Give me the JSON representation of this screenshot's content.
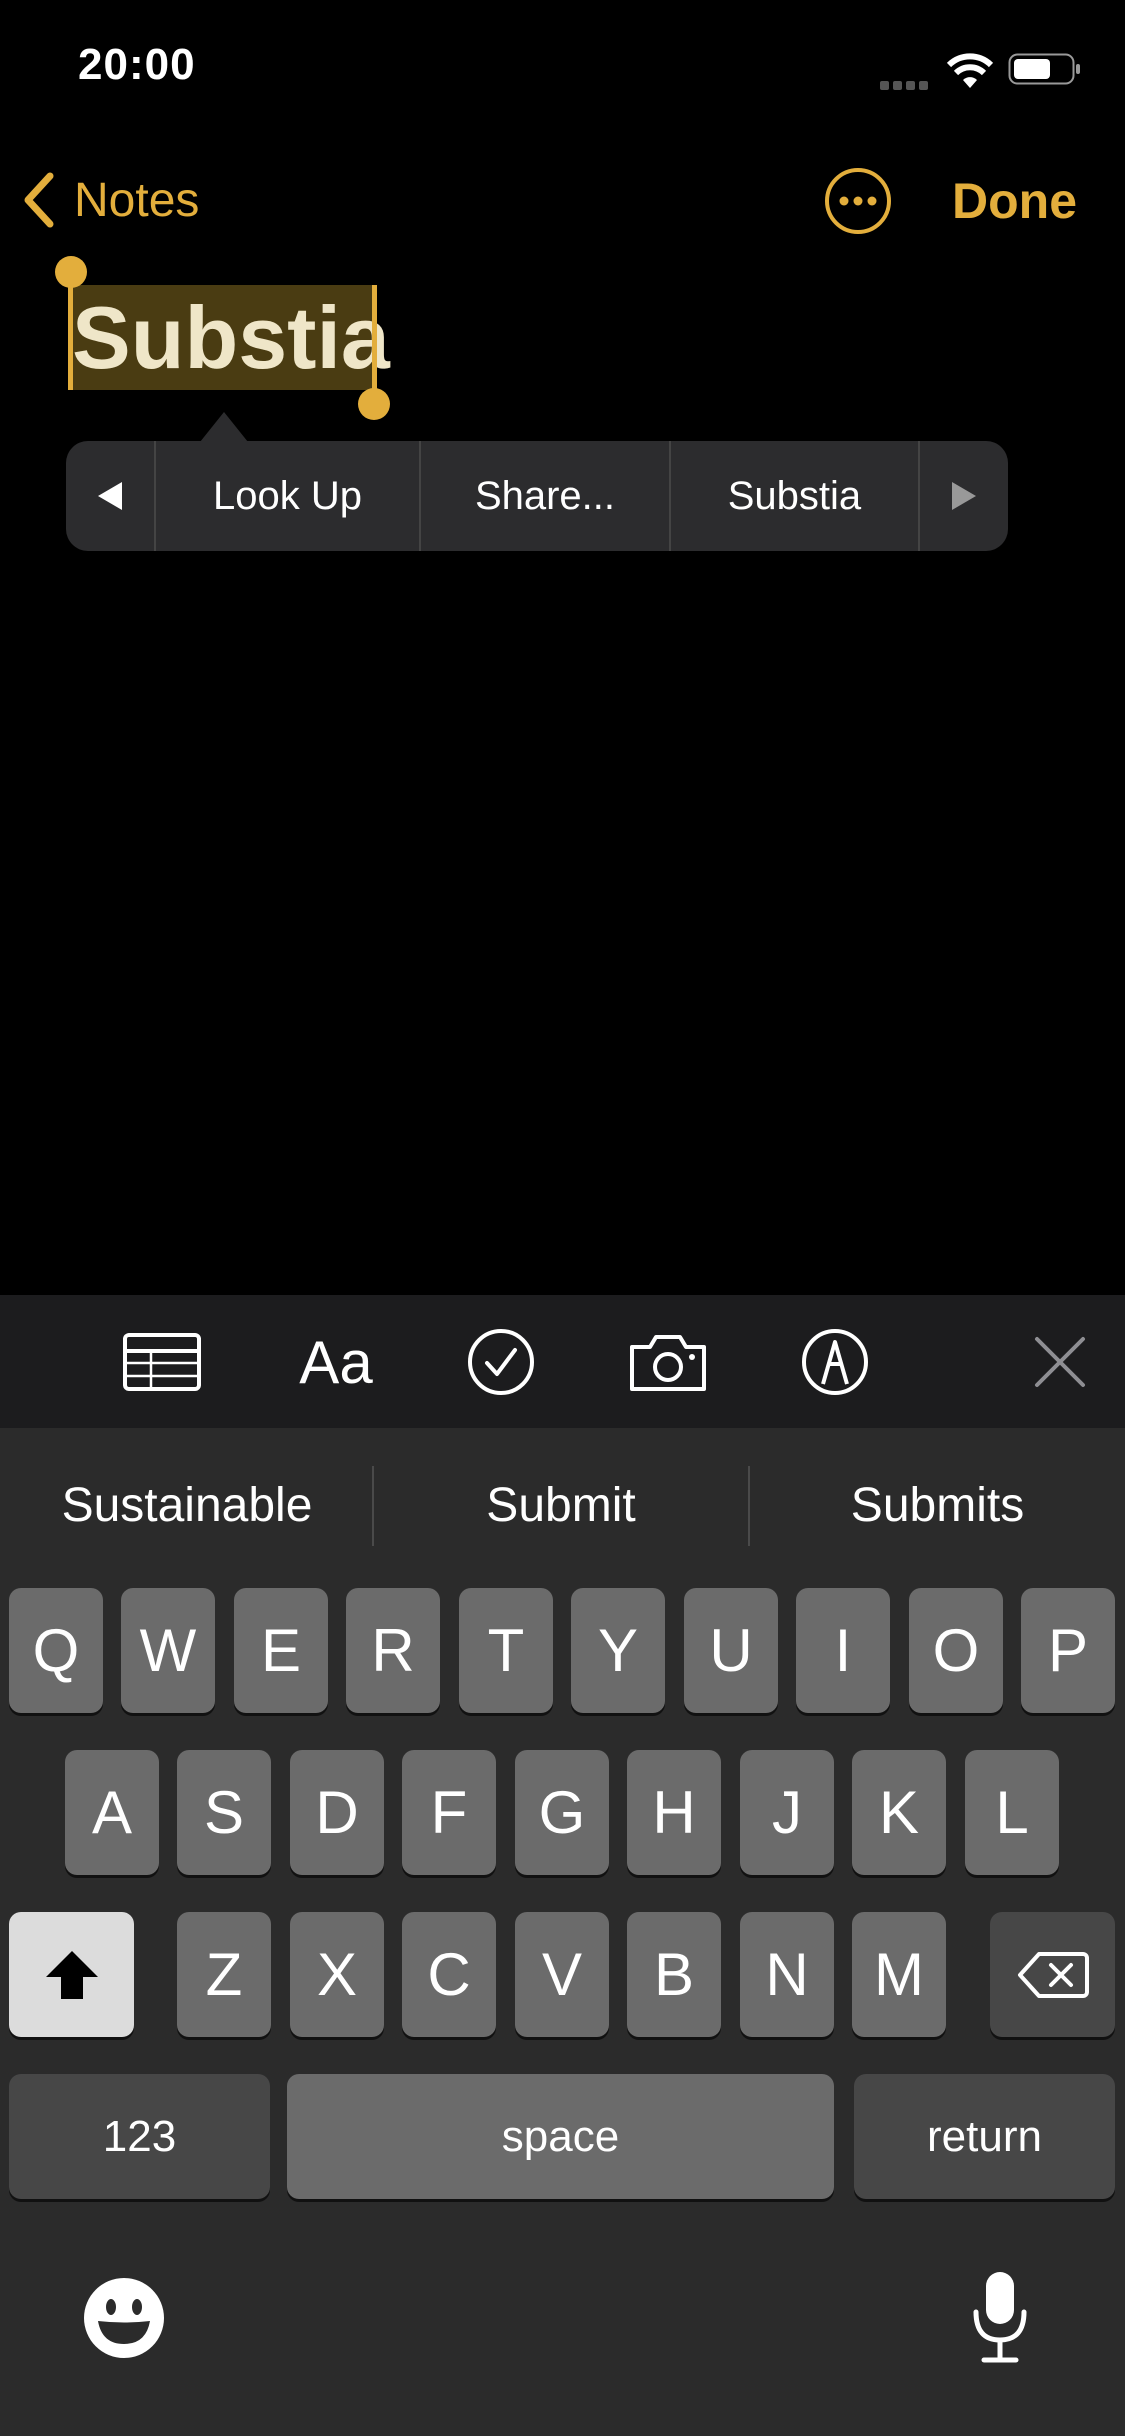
{
  "status_bar": {
    "time": "20:00"
  },
  "nav": {
    "back_label": "Notes",
    "done_label": "Done"
  },
  "note": {
    "title": "Substia"
  },
  "context_menu": {
    "items": [
      "Look Up",
      "Share...",
      "Substia"
    ]
  },
  "toolbar": {
    "icons": [
      "table-icon",
      "text-format-icon",
      "checklist-icon",
      "camera-icon",
      "markup-icon",
      "close-icon"
    ],
    "format_label": "Aa"
  },
  "keyboard": {
    "suggestions": [
      "Sustainable",
      "Submit",
      "Submits"
    ],
    "row1": [
      "Q",
      "W",
      "E",
      "R",
      "T",
      "Y",
      "U",
      "I",
      "O",
      "P"
    ],
    "row2": [
      "A",
      "S",
      "D",
      "F",
      "G",
      "H",
      "J",
      "K",
      "L"
    ],
    "row3": [
      "Z",
      "X",
      "C",
      "V",
      "B",
      "N",
      "M"
    ],
    "numbers_label": "123",
    "space_label": "space",
    "return_label": "return"
  },
  "colors": {
    "accent": "#E3AE3C",
    "background": "#000000",
    "keyboard": "#2B2B2B"
  }
}
